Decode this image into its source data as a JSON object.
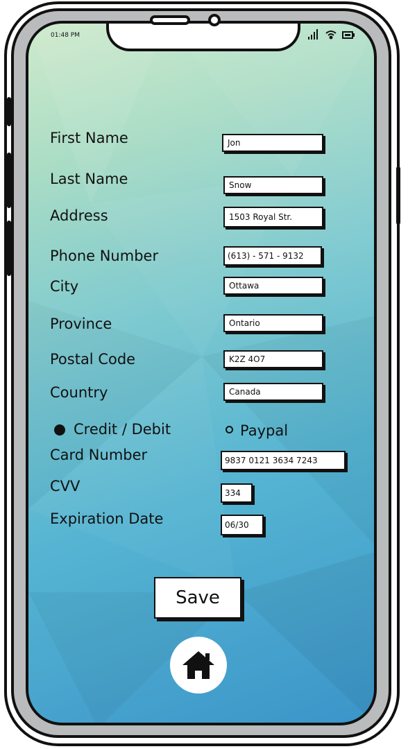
{
  "status_bar": {
    "time": "01:48 PM"
  },
  "form": {
    "first_name": {
      "label": "First Name",
      "value": "Jon"
    },
    "last_name": {
      "label": "Last Name",
      "value": "Snow"
    },
    "address": {
      "label": "Address",
      "value": "1503 Royal Str."
    },
    "phone": {
      "label": "Phone Number",
      "value": "(613) - 571 - 9132"
    },
    "city": {
      "label": "City",
      "value": "Ottawa"
    },
    "province": {
      "label": "Province",
      "value": "Ontario"
    },
    "postal_code": {
      "label": "Postal Code",
      "value": "K2Z 4O7"
    },
    "country": {
      "label": "Country",
      "value": "Canada"
    }
  },
  "payment": {
    "options": [
      {
        "label": "Credit / Debit",
        "selected": true
      },
      {
        "label": "Paypal",
        "selected": false
      }
    ],
    "card_number": {
      "label": "Card Number",
      "value": "9837 0121 3634 7243"
    },
    "cvv": {
      "label": "CVV",
      "value": "334"
    },
    "expiration": {
      "label": "Expiration Date",
      "value": "06/30"
    }
  },
  "actions": {
    "save_label": "Save"
  },
  "icons": {
    "home": "home-icon",
    "signal": "signal-icon",
    "wifi": "wifi-icon",
    "battery": "battery-icon",
    "radio_selected": "radio-selected-icon",
    "radio_unselected": "radio-unselected-icon"
  },
  "colors": {
    "ink": "#111111",
    "field_bg": "#ffffff",
    "bezel": "#b9bbbd"
  }
}
